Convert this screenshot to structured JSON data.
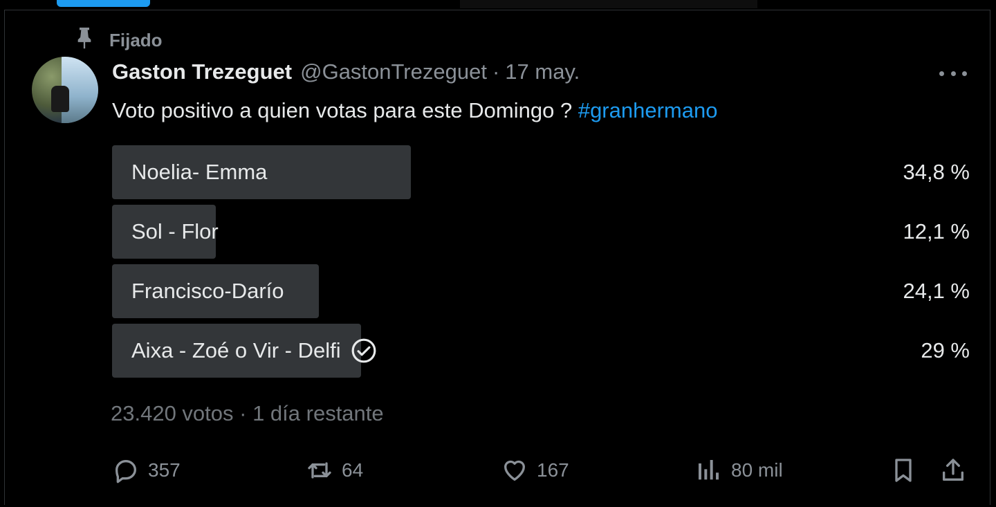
{
  "pinned_label": "Fijado",
  "tweet": {
    "author_name": "Gaston Trezeguet",
    "handle": "@GastonTrezeguet",
    "separator": "·",
    "date": "17 may.",
    "text": "Voto positivo a quien votas para este Domingo ?",
    "hashtag": "#granhermano"
  },
  "poll": {
    "options": [
      {
        "label": "Noelia- Emma",
        "percent_text": "34,8 %",
        "fill_fraction": 0.348,
        "selected": false
      },
      {
        "label": "Sol - Flor",
        "percent_text": "12,1 %",
        "fill_fraction": 0.121,
        "selected": false
      },
      {
        "label": "Francisco-Darío",
        "percent_text": "24,1 %",
        "fill_fraction": 0.241,
        "selected": false
      },
      {
        "label": "Aixa - Zoé o Vir - Delfi",
        "percent_text": "29 %",
        "fill_fraction": 0.29,
        "selected": true
      }
    ],
    "meta": "23.420 votos · 1 día restante"
  },
  "actions": {
    "replies": "357",
    "reposts": "64",
    "likes": "167",
    "views": "80 mil"
  },
  "icons": {
    "pin": "pin-icon",
    "more": "more-icon",
    "check": "check-circle-icon",
    "reply": "reply-icon",
    "repost": "repost-icon",
    "like": "heart-icon",
    "views": "views-icon",
    "bookmark": "bookmark-icon",
    "share": "share-icon"
  },
  "colors": {
    "background": "#000000",
    "accent": "#1d9bf0",
    "poll_fill": "#333639",
    "muted": "#8b9198"
  }
}
